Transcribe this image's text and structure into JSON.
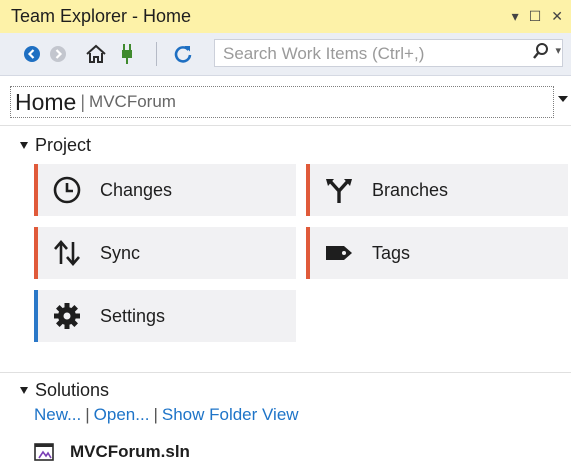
{
  "window": {
    "title": "Team Explorer - Home",
    "controls": [
      "▾",
      "☐",
      "✕"
    ]
  },
  "toolbar": {
    "buttons": [
      "back-icon",
      "forward-icon",
      "home-icon",
      "connect-icon",
      "refresh-icon"
    ],
    "search_placeholder": "Search Work Items (Ctrl+,)"
  },
  "breadcrumb": {
    "page": "Home",
    "separator": "|",
    "project": "MVCForum"
  },
  "project_section": {
    "title": "Project",
    "tiles": [
      {
        "label": "Changes",
        "icon": "clock-icon",
        "accent": "#e05a3a"
      },
      {
        "label": "Branches",
        "icon": "branch-icon",
        "accent": "#e05a3a"
      },
      {
        "label": "Sync",
        "icon": "sync-arrows-icon",
        "accent": "#e05a3a"
      },
      {
        "label": "Tags",
        "icon": "tag-icon",
        "accent": "#e05a3a"
      },
      {
        "label": "Settings",
        "icon": "gear-icon",
        "accent": "#2a78c8"
      }
    ]
  },
  "solutions_section": {
    "title": "Solutions",
    "links": [
      "New...",
      "Open...",
      "Show Folder View"
    ],
    "separator": "|",
    "solution_file": "MVCForum.sln"
  },
  "colors": {
    "titlebar_bg": "#fdf2a8",
    "toolbar_bg": "#ebeef4",
    "link": "#1e74c8",
    "tile_bg": "#f1f1f3"
  }
}
